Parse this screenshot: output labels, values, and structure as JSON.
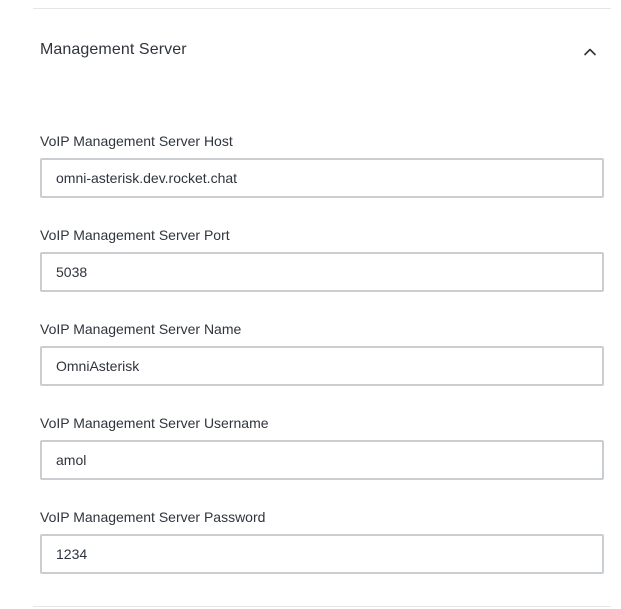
{
  "section": {
    "title": "Management Server",
    "expanded": true,
    "chevron_icon": "chevron-up-icon"
  },
  "fields": [
    {
      "label": "VoIP Management Server Host",
      "value": "omni-asterisk.dev.rocket.chat"
    },
    {
      "label": "VoIP Management Server Port",
      "value": "5038"
    },
    {
      "label": "VoIP Management Server Name",
      "value": "OmniAsterisk"
    },
    {
      "label": "VoIP Management Server Username",
      "value": "amol"
    },
    {
      "label": "VoIP Management Server Password",
      "value": "1234"
    }
  ],
  "colors": {
    "text": "#2f343d",
    "border": "#cbced1",
    "divider": "#e4e7ea"
  }
}
